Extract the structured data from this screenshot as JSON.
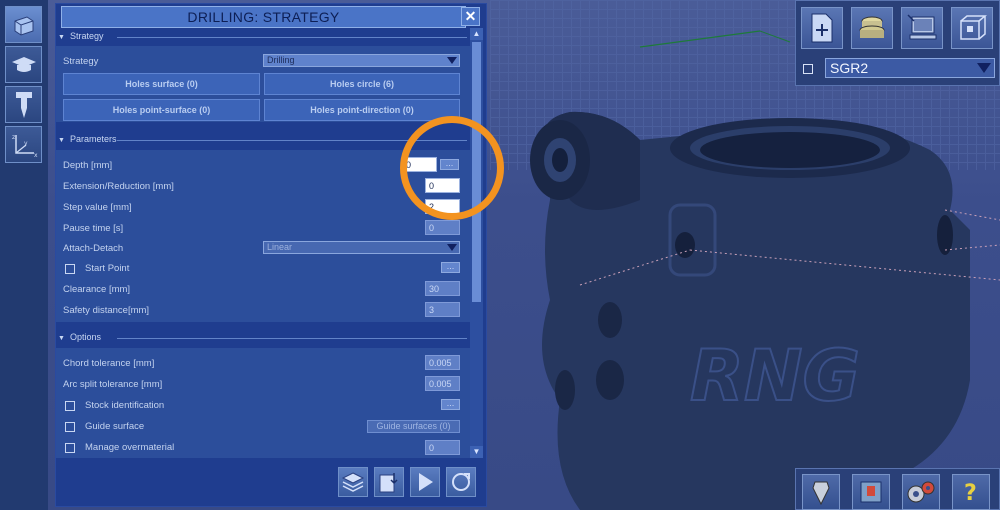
{
  "panel": {
    "title": "DRILLING: STRATEGY",
    "close": "✕"
  },
  "sections": {
    "strategy": {
      "header": "Strategy",
      "strategy_label": "Strategy",
      "strategy_value": "Drilling",
      "buttons": [
        "Holes surface (0)",
        "Holes circle (6)",
        "Holes point-surface (0)",
        "Holes point-direction (0)"
      ]
    },
    "parameters": {
      "header": "Parameters",
      "depth_label": "Depth [mm]",
      "depth_value": "0",
      "depth_dots": "…",
      "extension_label": "Extension/Reduction [mm]",
      "extension_value": "0",
      "step_label": "Step value [mm]",
      "step_value": "2",
      "pause_label": "Pause time [s]",
      "pause_value": "0",
      "attach_label": "Attach-Detach",
      "attach_value": "Linear",
      "start_point_label": "Start Point",
      "start_point_dots": "…",
      "clearance_label": "Clearance [mm]",
      "clearance_value": "30",
      "safety_label": "Safety distance[mm]",
      "safety_value": "3"
    },
    "options": {
      "header": "Options",
      "chord_label": "Chord tolerance [mm]",
      "chord_value": "0.005",
      "arc_label": "Arc split tolerance [mm]",
      "arc_value": "0.005",
      "stock_label": "Stock identification",
      "stock_dots": "…",
      "guide_label": "Guide surface",
      "guide_button": "Guide surfaces (0)",
      "overmaterial_label": "Manage overmaterial",
      "overmaterial_value": "0"
    }
  },
  "top_right": {
    "select_value": "SGR2"
  },
  "colors": {
    "accent_ring": "#f39320",
    "panel_bg": "#1f3d8f",
    "viewport_bg": "#3d4f8a"
  },
  "icons": {
    "left_toolbar": [
      "cube-icon",
      "graduation-cap-icon",
      "drill-tool-icon",
      "axes-icon"
    ],
    "footer": [
      "layers-icon",
      "clipboard-export-icon",
      "play-icon",
      "refresh-icon"
    ],
    "top_right": [
      "add-page-icon",
      "stock-stack-icon",
      "computer-icon",
      "view-cube-icon"
    ],
    "bottom_right": [
      "tool-cone-icon",
      "machine-icon",
      "gears-icon",
      "help-icon"
    ]
  }
}
